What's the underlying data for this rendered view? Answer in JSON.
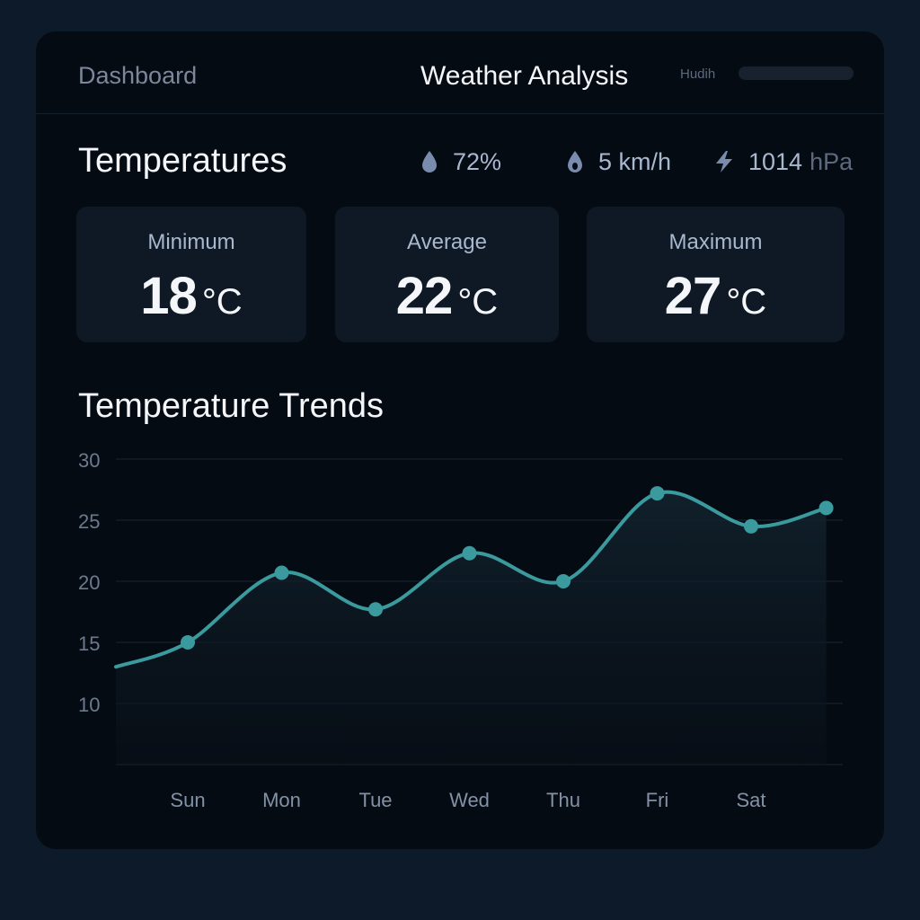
{
  "header": {
    "nav_label": "Dashboard",
    "title": "Weather Analysis",
    "user_label": "Hudih"
  },
  "temperatures": {
    "title": "Temperatures",
    "humidity": "72%",
    "wind": "5 km/h",
    "pressure_value": "1014",
    "pressure_unit": "hPa",
    "cards": [
      {
        "label": "Minimum",
        "value": "18",
        "unit": "°C"
      },
      {
        "label": "Average",
        "value": "22",
        "unit": "°C"
      },
      {
        "label": "Maximum",
        "value": "27",
        "unit": "°C"
      }
    ]
  },
  "trends": {
    "title": "Temperature Trends"
  },
  "colors": {
    "accent": "#3a9a9d",
    "panel": "#050b13",
    "card": "#0e1925",
    "background": "#0d1a29"
  },
  "icons": {
    "humidity": "droplet-icon",
    "wind": "droplet-icon",
    "pressure": "lightning-icon"
  },
  "chart_data": {
    "type": "line",
    "categories": [
      "Sun",
      "Mon",
      "Tue",
      "Wed",
      "Thu",
      "Fri",
      "Sat"
    ],
    "series": [
      {
        "values": [
          15,
          20.7,
          17.7,
          22.3,
          20,
          27.2,
          24.5,
          26
        ]
      }
    ],
    "x_points": [
      0,
      1,
      2,
      3,
      4,
      5,
      6,
      6.8
    ],
    "line_start": 13,
    "yticks": [
      30,
      25,
      20,
      15,
      10
    ],
    "ylim": [
      5,
      30
    ],
    "grid": true,
    "smooth": true
  }
}
